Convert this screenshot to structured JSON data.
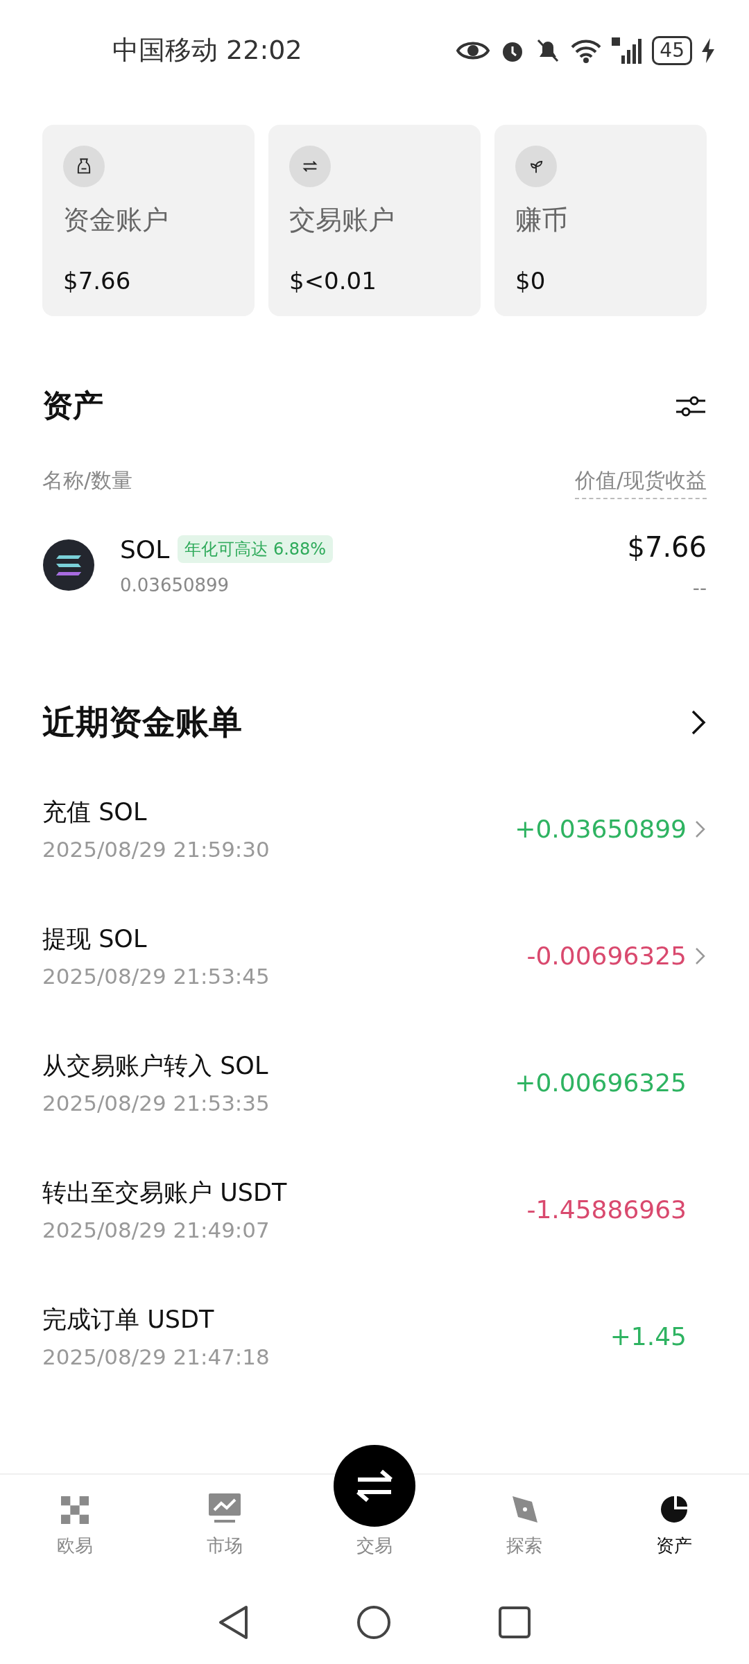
{
  "status_bar": {
    "carrier": "中国移动",
    "time": "22:02",
    "battery": "45"
  },
  "accounts": [
    {
      "kind": "fund",
      "name": "资金账户",
      "value": "$7.66"
    },
    {
      "kind": "trade",
      "name": "交易账户",
      "value": "$<0.01"
    },
    {
      "kind": "earn",
      "name": "赚币",
      "value": "$0"
    }
  ],
  "assets": {
    "title": "资产",
    "columns": [
      "名称/数量",
      "价值/现货收益"
    ],
    "rows": [
      {
        "symbol": "SOL",
        "badge": "年化可高达 6.88%",
        "amount": "0.03650899",
        "value": "$7.66",
        "pnl": "--"
      }
    ]
  },
  "bills": {
    "title": "近期资金账单",
    "rows": [
      {
        "title": "充值 SOL",
        "time": "2025/08/29 21:59:30",
        "amount": "+0.03650899",
        "kind": "credit",
        "has_detail": true
      },
      {
        "title": "提现 SOL",
        "time": "2025/08/29 21:53:45",
        "amount": "-0.00696325",
        "kind": "debit",
        "has_detail": true
      },
      {
        "title": "从交易账户转入 SOL",
        "time": "2025/08/29 21:53:35",
        "amount": "+0.00696325",
        "kind": "credit",
        "has_detail": false
      },
      {
        "title": "转出至交易账户 USDT",
        "time": "2025/08/29 21:49:07",
        "amount": "-1.45886963",
        "kind": "debit",
        "has_detail": false
      },
      {
        "title": "完成订单 USDT",
        "time": "2025/08/29 21:47:18",
        "amount": "+1.45",
        "kind": "credit",
        "has_detail": false
      }
    ]
  },
  "tab_bar": [
    {
      "kind": "home",
      "label": "欧易",
      "selected": false
    },
    {
      "kind": "market",
      "label": "市场",
      "selected": false
    },
    {
      "kind": "trade",
      "label": "交易",
      "selected": false
    },
    {
      "kind": "explore",
      "label": "探索",
      "selected": false
    },
    {
      "kind": "assets",
      "label": "资产",
      "selected": true
    }
  ]
}
